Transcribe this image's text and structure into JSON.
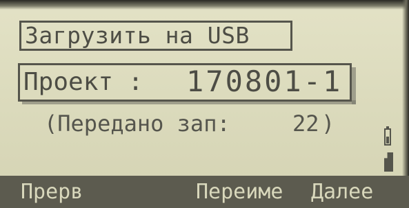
{
  "screen": {
    "title": "Загрузить на USB",
    "project_label": "Проект :",
    "project_value": "170801-1",
    "transfer_label": "(Передано зап:",
    "transfer_count": "22",
    "transfer_close": ")"
  },
  "status_icons": [
    "battery-icon",
    "memory-card-icon"
  ],
  "softkeys": [
    {
      "label": "Прерв"
    },
    {
      "label": "Переиме"
    },
    {
      "label": "Далее"
    }
  ],
  "colors": {
    "screen_bg": "#dcdbbd",
    "text": "#4d4d45",
    "softkey_bar": "#5c5b4f",
    "softkey_text": "#d9d8bc"
  }
}
